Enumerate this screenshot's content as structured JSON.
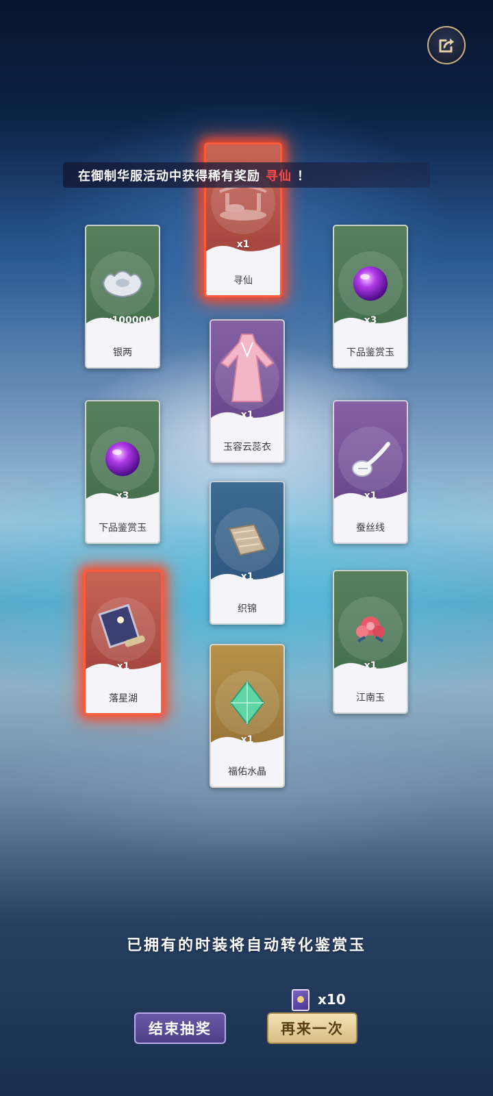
{
  "banner": {
    "prefix": "在御制华服活动中获得稀有奖励",
    "reward": "寻仙",
    "suffix": "！"
  },
  "cards": [
    {
      "name": "寻仙",
      "qty": "x1"
    },
    {
      "name": "银两",
      "qty": "x100000"
    },
    {
      "name": "下品鉴赏玉",
      "qty": "x3"
    },
    {
      "name": "玉容云蕊衣",
      "qty": "x1"
    },
    {
      "name": "下品鉴赏玉",
      "qty": "x3"
    },
    {
      "name": "蚕丝线",
      "qty": "x1"
    },
    {
      "name": "织锦",
      "qty": "x1"
    },
    {
      "name": "落星湖",
      "qty": "x1"
    },
    {
      "name": "江南玉",
      "qty": "x1"
    },
    {
      "name": "福佑水晶",
      "qty": "x1"
    }
  ],
  "notice": "已拥有的时装将自动转化鉴赏玉",
  "ticket": {
    "count": "x10"
  },
  "buttons": {
    "end_label": "结束抽奖",
    "again_label": "再来一次"
  },
  "icons": {
    "share": "share-icon",
    "ticket": "ticket-icon"
  },
  "colors": {
    "rare_glow": "#ff5a3a",
    "highlight_text": "#ff4a4a"
  }
}
